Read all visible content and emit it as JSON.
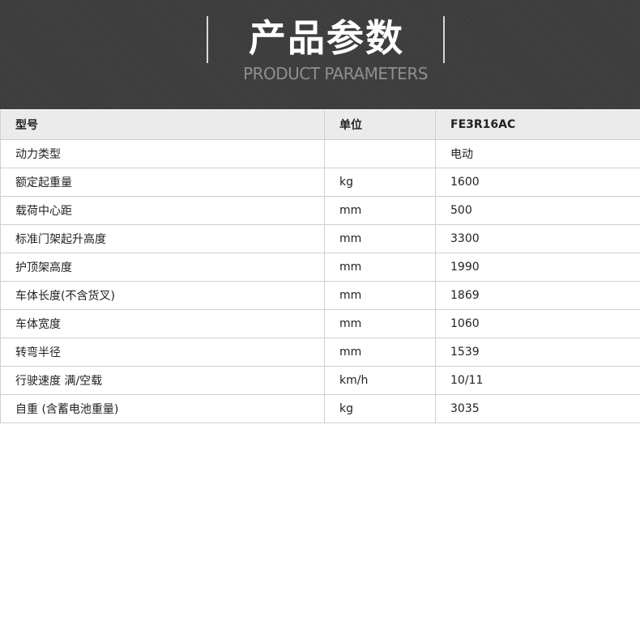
{
  "banner": {
    "title": "产品参数",
    "subtitle": "PRODUCT PARAMETERS"
  },
  "table": {
    "headers": [
      "型号",
      "单位",
      "FE3R16AC"
    ],
    "rows": [
      {
        "name": "动力类型",
        "unit": "",
        "value": "电动"
      },
      {
        "name": "额定起重量",
        "unit": "kg",
        "value": "1600"
      },
      {
        "name": "载荷中心距",
        "unit": "mm",
        "value": "500"
      },
      {
        "name": "标准门架起升高度",
        "unit": "mm",
        "value": "3300"
      },
      {
        "name": "护顶架高度",
        "unit": "mm",
        "value": "1990"
      },
      {
        "name": "车体长度(不含货叉)",
        "unit": "mm",
        "value": "1869"
      },
      {
        "name": "车体宽度",
        "unit": "mm",
        "value": "1060"
      },
      {
        "name": "转弯半径",
        "unit": "mm",
        "value": "1539"
      },
      {
        "name": "行驶速度 满/空载",
        "unit": "km/h",
        "value": "10/11"
      },
      {
        "name": "自重 (含蓄电池重量)",
        "unit": "kg",
        "value": "3035"
      }
    ]
  }
}
